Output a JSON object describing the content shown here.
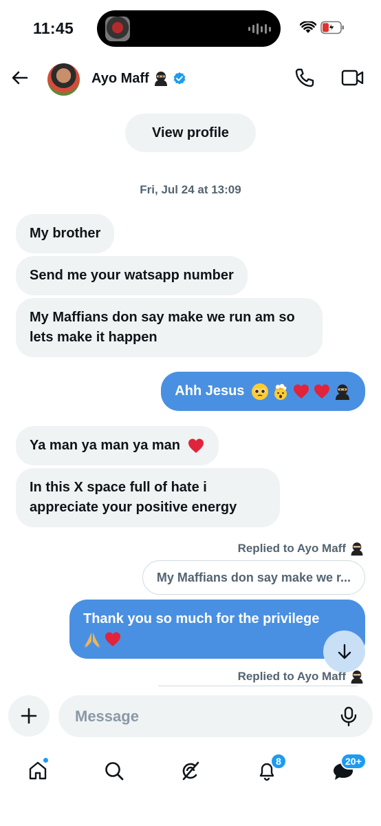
{
  "status_bar": {
    "time": "11:45"
  },
  "header": {
    "contact_name": "Ayo Maff",
    "verified": true
  },
  "chat": {
    "view_profile_label": "View profile",
    "date_stamp": "Fri, Jul 24 at 13:09",
    "messages": [
      {
        "side": "in",
        "text": "My brother"
      },
      {
        "side": "in",
        "text": "Send me your watsapp number"
      },
      {
        "side": "in",
        "text": "My Maffians don say make we run am so lets make it happen"
      },
      {
        "side": "out",
        "text": "Ahh Jesus",
        "emojis": [
          "pleading-face",
          "exploding-head",
          "red-heart",
          "red-heart",
          "ninja"
        ]
      },
      {
        "side": "in",
        "text": "Ya man ya man ya man",
        "emojis": [
          "red-heart"
        ]
      },
      {
        "side": "in",
        "text": "In this X space full of hate i appreciate your positive energy"
      },
      {
        "side": "out",
        "replied_to": "Replied to Ayo Maff",
        "quote": "My Maffians don say make we r...",
        "text": "Thank you so much for the privilege",
        "emojis": [
          "folded-hands",
          "red-heart"
        ]
      },
      {
        "side": "out",
        "replied_to": "Replied to Ayo Maff"
      }
    ]
  },
  "composer": {
    "placeholder": "Message"
  },
  "tabbar": {
    "items": [
      {
        "name": "home",
        "has_dot": true
      },
      {
        "name": "search"
      },
      {
        "name": "grok"
      },
      {
        "name": "notifications",
        "badge": "8"
      },
      {
        "name": "messages",
        "badge": "20+"
      }
    ]
  },
  "colors": {
    "accent": "#1d9bf0",
    "outgoing_bubble": "#4a90e2",
    "incoming_bubble": "#eff3f4",
    "muted_text": "#536471"
  }
}
